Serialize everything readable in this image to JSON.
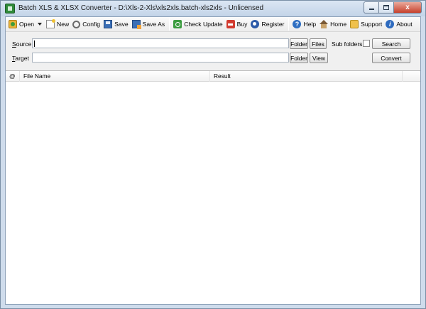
{
  "window": {
    "title": "Batch XLS & XLSX Converter - D:\\Xls-2-Xls\\xls2xls.batch-xls2xls - Unlicensed",
    "close_glyph": "x"
  },
  "toolbar": {
    "open": "Open",
    "new": "New",
    "config": "Config",
    "save": "Save",
    "save_as": "Save As",
    "check_update": "Check Update",
    "buy": "Buy",
    "register": "Register",
    "help": "Help",
    "home": "Home",
    "support": "Support",
    "about": "About",
    "help_glyph": "?",
    "about_glyph": "i"
  },
  "form": {
    "source_label_access": "S",
    "source_label_rest": "ource",
    "source_value": "",
    "target_label_access": "T",
    "target_label_rest": "arget",
    "target_value": "",
    "folder": "Folder",
    "files": "Files",
    "view": "View",
    "subfolders_label": "Sub folders",
    "subfolders_checked": false,
    "search": "Search",
    "convert": "Convert"
  },
  "list": {
    "columns": [
      "@",
      "File Name",
      "Result"
    ],
    "rows": []
  }
}
